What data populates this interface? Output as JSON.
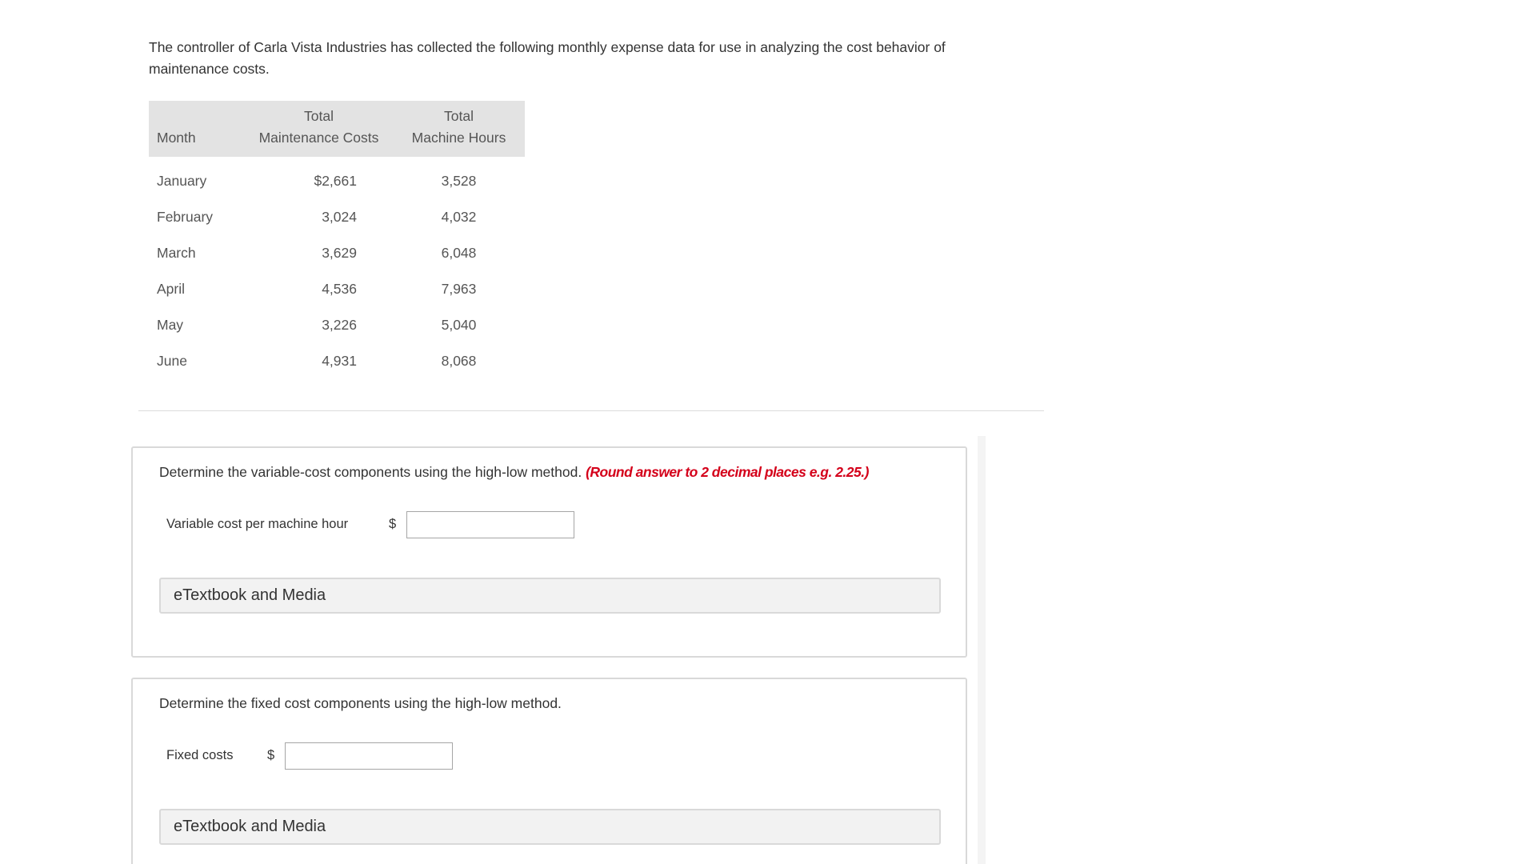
{
  "intro": {
    "text": "The controller of Carla Vista Industries has collected the following monthly expense data for use in analyzing the cost behavior of maintenance costs."
  },
  "table": {
    "headers": {
      "month": "Month",
      "cost_line1": "Total",
      "cost_line2": "Maintenance Costs",
      "hours_line1": "Total",
      "hours_line2": "Machine Hours"
    },
    "rows": [
      {
        "month": "January",
        "cost": "$2,661",
        "hours": "3,528"
      },
      {
        "month": "February",
        "cost": "3,024",
        "hours": "4,032"
      },
      {
        "month": "March",
        "cost": "3,629",
        "hours": "6,048"
      },
      {
        "month": "April",
        "cost": "4,536",
        "hours": "7,963"
      },
      {
        "month": "May",
        "cost": "3,226",
        "hours": "5,040"
      },
      {
        "month": "June",
        "cost": "4,931",
        "hours": "8,068"
      }
    ]
  },
  "question1": {
    "text": "Determine the variable-cost components using the high-low method.",
    "hint": "(Round answer to 2 decimal places e.g. 2.25.)",
    "label": "Variable cost per machine hour",
    "currency": "$",
    "value": "",
    "etextbook": "eTextbook and Media"
  },
  "question2": {
    "text": "Determine the fixed cost components using the high-low method.",
    "label": "Fixed costs",
    "currency": "$",
    "value": "",
    "etextbook": "eTextbook and Media"
  },
  "colors": {
    "hint": "#d4001a",
    "header_bg": "#e3e3e3",
    "panel_border": "#d9d9d9"
  }
}
